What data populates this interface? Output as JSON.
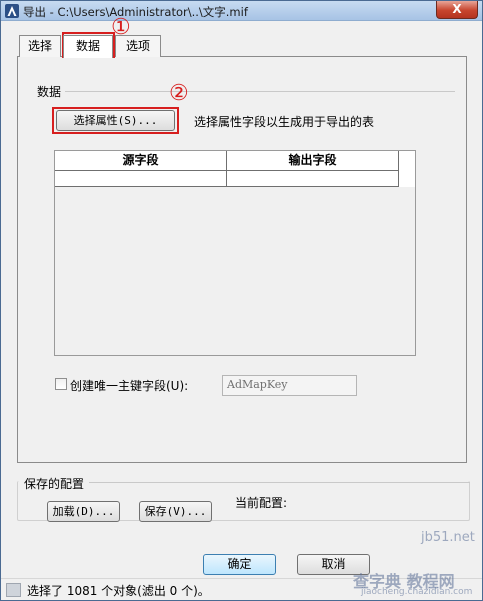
{
  "window": {
    "title": "导出 - C:\\Users\\Administrator\\..\\文字.mif",
    "close_glyph": "X"
  },
  "tabs": [
    {
      "label": "选择"
    },
    {
      "label": "数据"
    },
    {
      "label": "选项"
    }
  ],
  "data_group": {
    "label": "数据",
    "select_attr_button": "选择属性(S)...",
    "select_attr_hint": "选择属性字段以生成用于导出的表"
  },
  "grid": {
    "columns": [
      "源字段",
      "输出字段"
    ]
  },
  "unique_key": {
    "checkbox_label": "创建唯一主键字段(U):",
    "checked": false,
    "field_value": "AdMapKey"
  },
  "config_group": {
    "label": "保存的配置",
    "load_button": "加载(D)...",
    "save_button": "保存(V)...",
    "current_label": "当前配置:"
  },
  "dialog_buttons": {
    "ok": "确定",
    "cancel": "取消"
  },
  "status": {
    "text": "选择了 1081 个对象(滤出 0 个)。"
  },
  "annotations": {
    "marker_1": "①",
    "marker_2": "②",
    "accent": "#d71f1f"
  },
  "watermarks": {
    "site": "jb51.net",
    "brand": "查字典 教程网",
    "url": "jiaocheng.chazidian.com"
  }
}
